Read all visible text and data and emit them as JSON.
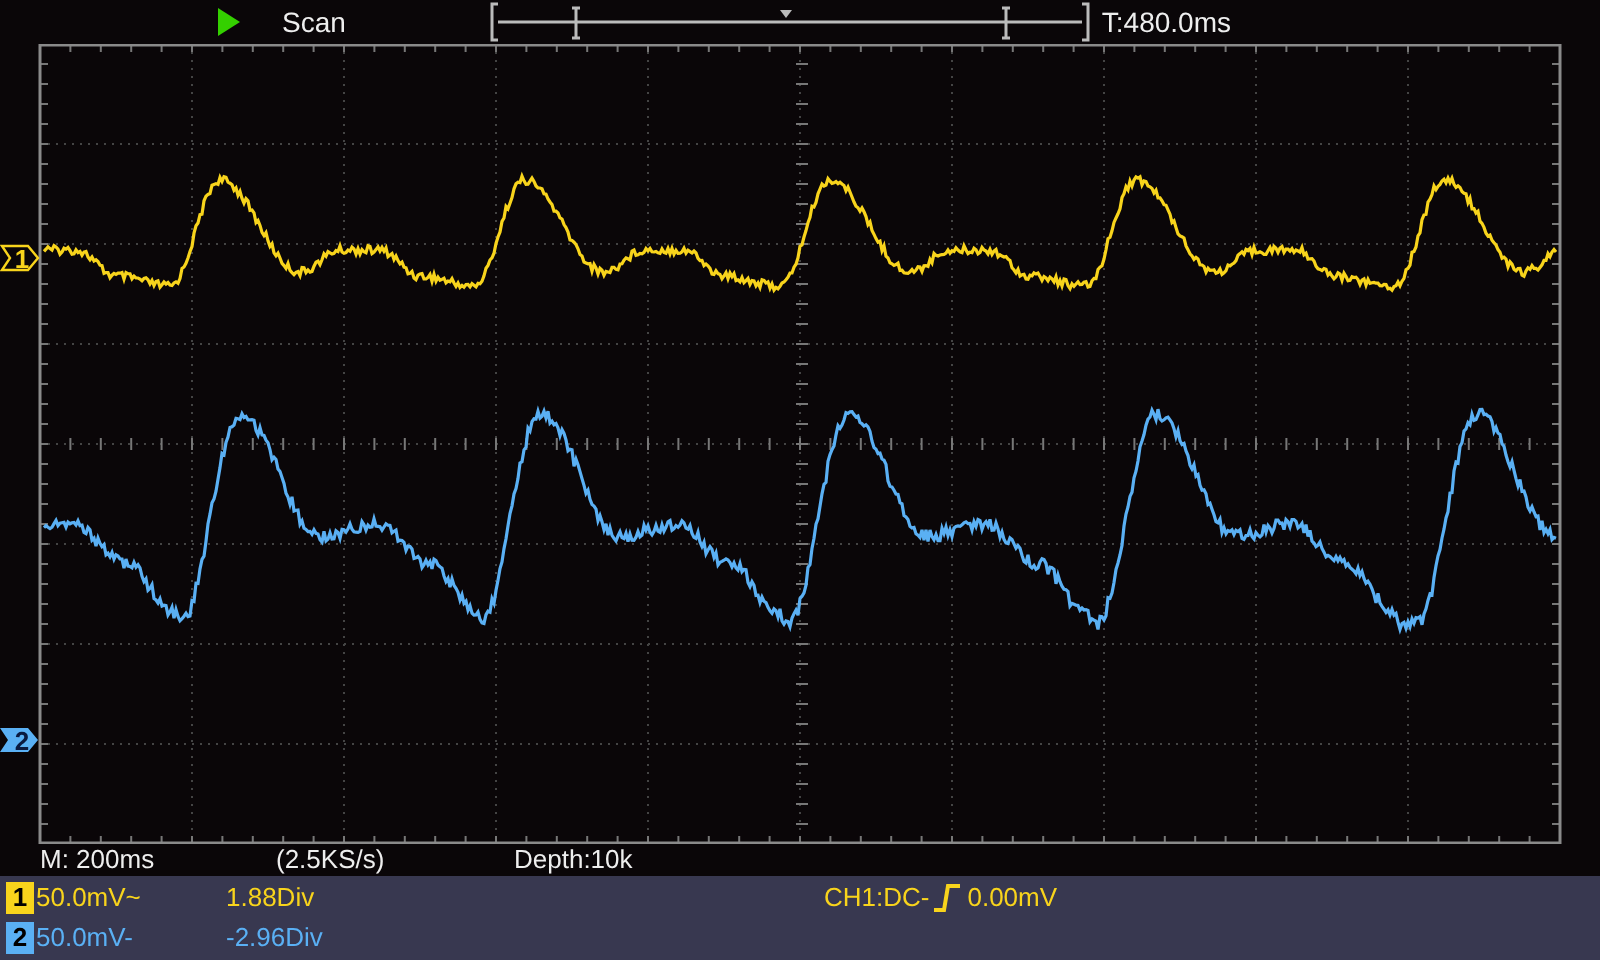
{
  "status": {
    "run_state": "Scan",
    "time_offset": "T:480.0ms"
  },
  "timebase": {
    "main": "M: 200ms",
    "sample_rate": "(2.5KS/s)",
    "depth": "Depth:10k"
  },
  "channels": [
    {
      "marker": "1",
      "badge": "1",
      "color": "#f8d41c",
      "volts_div": "50.0mV~",
      "position": "1.88Div"
    },
    {
      "marker": "2",
      "badge": "2",
      "color": "#5ab0f4",
      "volts_div": "50.0mV-",
      "position": "-2.96Div"
    }
  ],
  "trigger": {
    "source": "CH1:DC-",
    "level": "0.00mV"
  }
}
